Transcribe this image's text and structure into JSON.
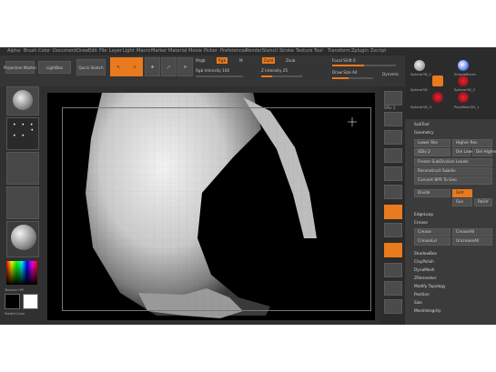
{
  "menubar": {
    "items": [
      "Alpha",
      "Brush",
      "Color",
      "Document",
      "Draw",
      "Edit",
      "File",
      "Layer",
      "Light",
      "Macro",
      "Marker",
      "Material",
      "Movie",
      "Picker",
      "Preferences",
      "Render",
      "Stencil",
      "Stroke",
      "Texture",
      "Tool",
      "Transform",
      "Zplugin",
      "Zscript"
    ]
  },
  "toolbar": {
    "projection_master": "Projection Master",
    "lightbox": "LightBox",
    "quick_sketch": "Quick Sketch",
    "edit": "Edit",
    "draw": "Draw",
    "move": "Move",
    "scale": "Scale",
    "rotate": "Rotate",
    "mrgb": "Mrgb",
    "rgb": "Rgb",
    "m": "M",
    "zadd": "Zadd",
    "zsub": "Zsub",
    "rgb_intensity_label": "Rgb Intensity 100",
    "z_intensity_label": "Z Intensity 25",
    "focal_shift_label": "Focal Shift 0",
    "draw_size_label": "Draw Size 64",
    "dynamic": "Dynamic"
  },
  "leftshelf": {
    "texture_off": "Texture Off",
    "gradient": "Gradient",
    "switch_color": "SwitchColor"
  },
  "rightshelf": {
    "bpr": "BPR",
    "spix": "SPix 3",
    "scroll": "Scroll",
    "zoom": "Zoom",
    "actual": "Actual",
    "aahalf": "AAHalf",
    "persp": "Persp",
    "floor": "Floor",
    "local": "Local",
    "xyz": "Xyz"
  },
  "rightpanel": {
    "lightbox_tools": [
      {
        "label": "Sphere3D_1",
        "icon": "sphere-icon"
      },
      {
        "label": "SimpleBrush",
        "icon": "brush-icon"
      },
      {
        "label": "Sphere3D",
        "icon": "sphere-icon"
      },
      {
        "label": "Sphere3D_2",
        "icon": "sphere-icon"
      },
      {
        "label": "Sphere3D_3",
        "icon": "sphere-icon"
      },
      {
        "label": "PolyMesh3D_1",
        "icon": "polymesh-icon"
      }
    ],
    "subtool": "SubTool",
    "geometry": "Geometry",
    "lower_res": "Lower Res",
    "higher_res": "Higher Res",
    "sdiv": "SDiv 2",
    "del_lower": "Del Lower",
    "del_higher": "Del Higher",
    "freeze_subdivision_levels": "Freeze SubDivision Levels",
    "reconstruct_subdiv": "Reconstruct Subdiv",
    "convert_bpr_to_geo": "Convert BPR To Geo",
    "divide": "Divide",
    "smt": "Smt",
    "suv": "Suv",
    "rsmt": "ReUV",
    "edgeloop": "EdgeLoop",
    "crease": "Crease",
    "crease_all": "CreaseAll",
    "crease_lvl": "CreaseLvl",
    "uncrease_all": "UncreaseAll",
    "shadowbox": "ShadowBox",
    "clay_polish": "ClayPolish",
    "dynamesh": "DynaMesh",
    "zremesher": "ZRemesher",
    "modify_topology": "Modify Topology",
    "position": "Position",
    "size": "Size",
    "meshintegrity": "MeshIntegrity"
  },
  "colors": {
    "accent": "#e97a1d",
    "canvas": "#000000",
    "ui_background": "#3a3a3a"
  }
}
